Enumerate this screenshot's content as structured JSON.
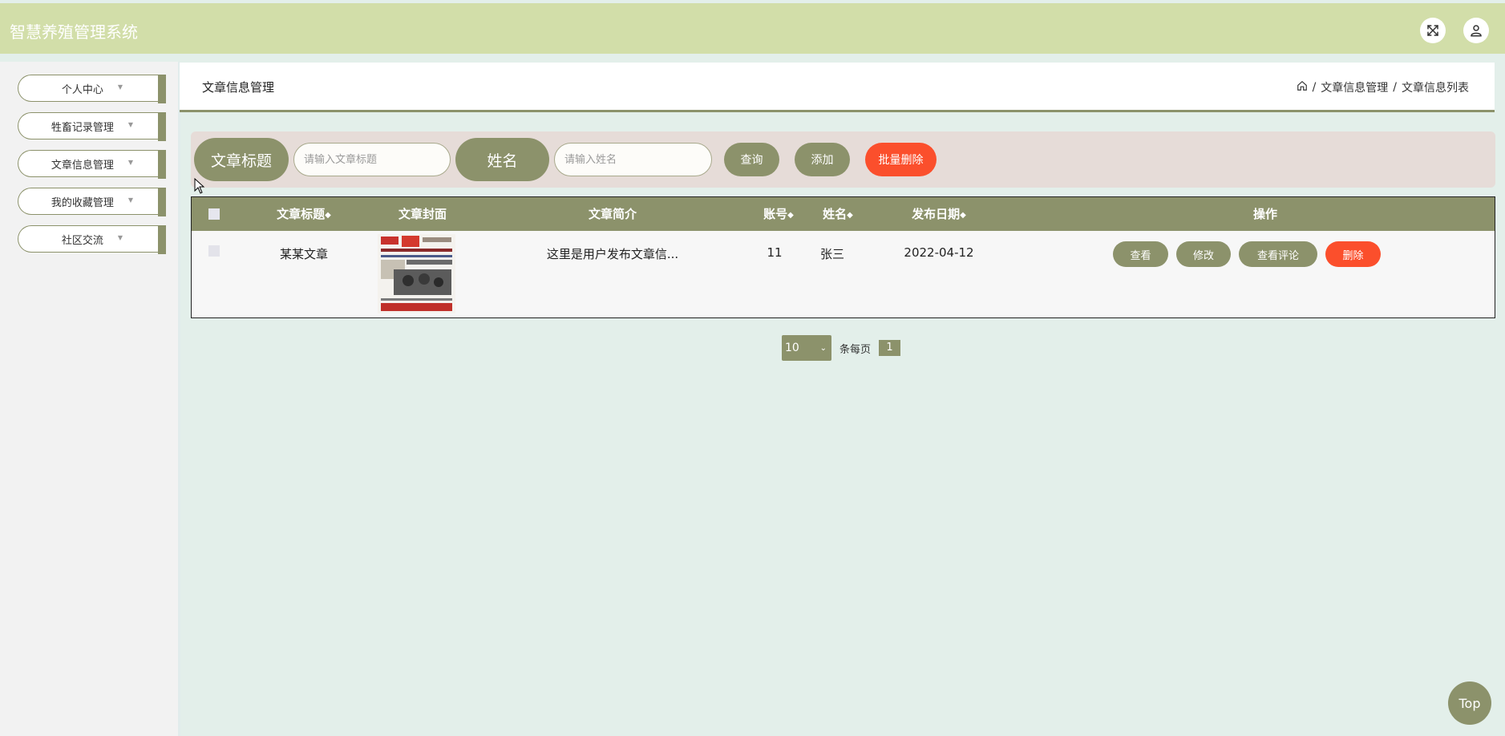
{
  "header": {
    "app_title": "智慧养殖管理系统",
    "icons": [
      "fullscreen-icon",
      "user-icon"
    ]
  },
  "sidebar": {
    "items": [
      {
        "label": "个人中心"
      },
      {
        "label": "牲畜记录管理"
      },
      {
        "label": "文章信息管理"
      },
      {
        "label": "我的收藏管理"
      },
      {
        "label": "社区交流"
      }
    ]
  },
  "page": {
    "title": "文章信息管理",
    "breadcrumb": [
      "文章信息管理",
      "文章信息列表"
    ]
  },
  "search": {
    "title_label": "文章标题",
    "title_placeholder": "请输入文章标题",
    "name_label": "姓名",
    "name_placeholder": "请输入姓名",
    "query_button": "查询",
    "add_button": "添加",
    "batch_delete_button": "批量删除"
  },
  "table": {
    "headers": {
      "title": "文章标题",
      "cover": "文章封面",
      "summary": "文章简介",
      "account": "账号",
      "name": "姓名",
      "date": "发布日期",
      "actions": "操作"
    },
    "rows": [
      {
        "title": "某某文章",
        "summary": "这里是用户发布文章信...",
        "account": "11",
        "name": "张三",
        "date": "2022-04-12",
        "actions": [
          "查看",
          "修改",
          "查看评论",
          "删除"
        ]
      }
    ]
  },
  "pagination": {
    "page_size": "10",
    "per_page_label": "条每页",
    "current_page": "1"
  },
  "back_to_top": "Top",
  "colors": {
    "header_bg": "#d2dea9",
    "accent_olive": "#8c926b",
    "danger": "#fb4f2c",
    "content_bg": "#e3efea"
  }
}
